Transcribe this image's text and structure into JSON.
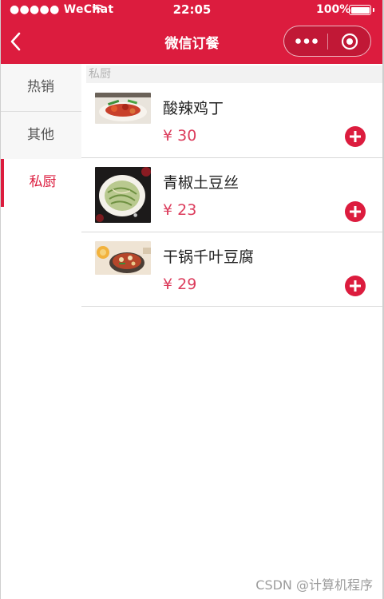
{
  "status_bar": {
    "carrier": "●●●●● WeChat",
    "wifi_icon": "wifi-icon",
    "time": "22:05",
    "battery_percent": "100%",
    "battery_level": 1.0
  },
  "navbar": {
    "title": "微信订餐",
    "back_icon": "chevron-left-icon",
    "more_icon": "more-dots-icon",
    "close_icon": "target-close-icon"
  },
  "theme": {
    "accent": "#dc1c3e",
    "price_color": "#dc3c5c",
    "sidebar_bg": "#f7f7f7"
  },
  "sidebar": {
    "items": [
      {
        "label": "热销",
        "active": false
      },
      {
        "label": "其他",
        "active": false
      },
      {
        "label": "私厨",
        "active": true
      }
    ]
  },
  "section": {
    "title": "私厨"
  },
  "dishes": [
    {
      "name": "酸辣鸡丁",
      "price": "¥ 30",
      "image_icon": "dish-photo"
    },
    {
      "name": "青椒土豆丝",
      "price": "¥ 23",
      "image_icon": "dish-photo"
    },
    {
      "name": "干锅千叶豆腐",
      "price": "¥ 29",
      "image_icon": "dish-photo"
    }
  ],
  "watermark": "CSDN @计算机程序"
}
